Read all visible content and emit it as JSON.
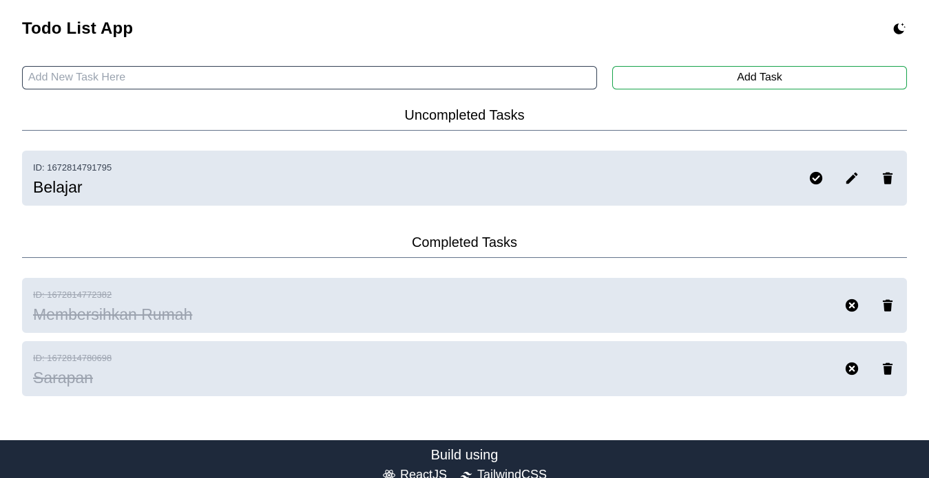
{
  "header": {
    "title": "Todo List App",
    "theme_icon": "moon-stars-icon"
  },
  "form": {
    "placeholder": "Add New Task Here",
    "value": "",
    "add_label": "Add Task"
  },
  "uncompleted": {
    "title": "Uncompleted Tasks",
    "tasks": [
      {
        "id_text": "ID: 1672814791795",
        "name": "Belajar"
      }
    ]
  },
  "completed": {
    "title": "Completed Tasks",
    "tasks": [
      {
        "id_text": "ID: 1672814772382",
        "name": "Membersihkan Rumah"
      },
      {
        "id_text": "ID: 1672814780698",
        "name": "Sarapan"
      }
    ]
  },
  "footer": {
    "title": "Build using",
    "tech": [
      {
        "label": "ReactJS",
        "icon": "react-icon"
      },
      {
        "label": "TailwindCSS",
        "icon": "tailwind-icon"
      }
    ]
  },
  "colors": {
    "card_bg": "#e2e8f0",
    "footer_bg": "#1e293b",
    "add_border": "#16a34a",
    "done_text": "#9ca3af"
  }
}
